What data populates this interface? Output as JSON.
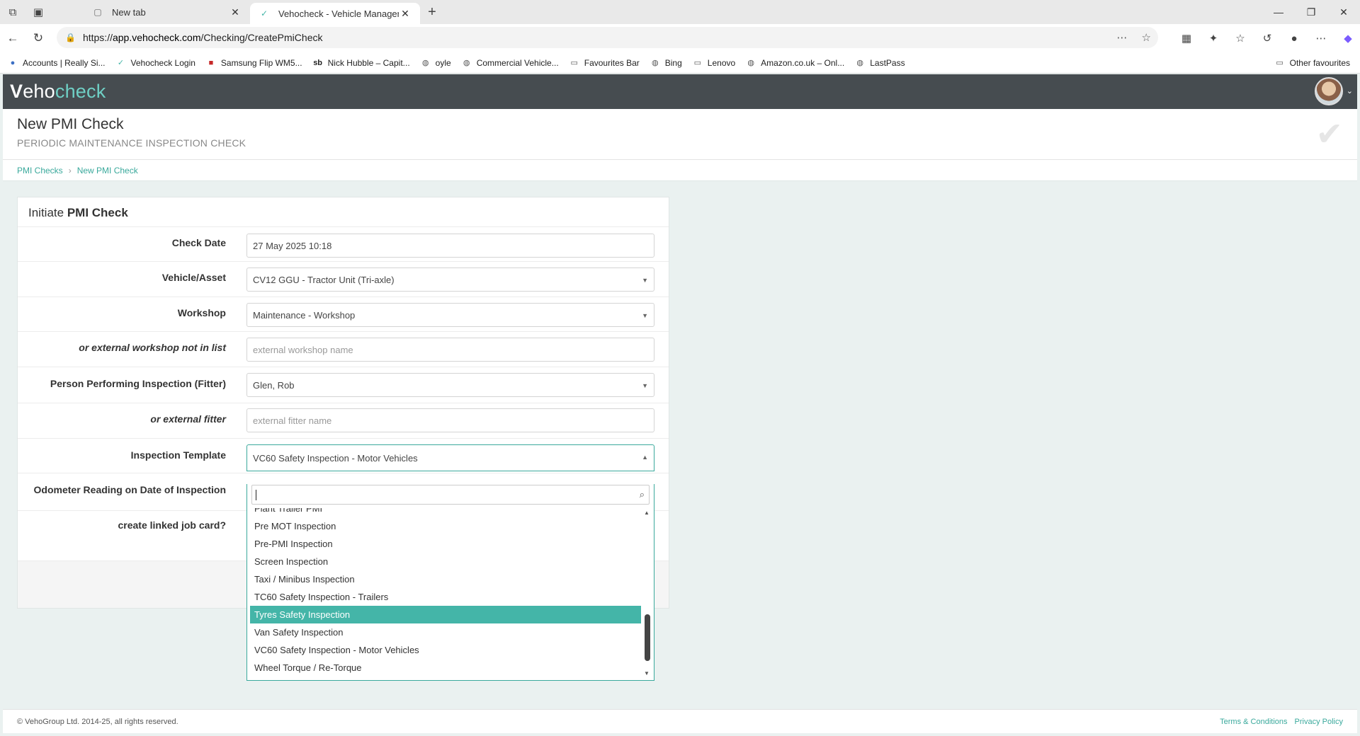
{
  "browser": {
    "tabs": [
      {
        "title": "New tab",
        "favicon": "page-icon"
      },
      {
        "title": "Vehocheck - Vehicle Management",
        "favicon": "vehocheck-icon"
      }
    ],
    "url_prefix": "https://",
    "url_host": "app.vehocheck.com",
    "url_path": "/Checking/CreatePmiCheck",
    "bookmarks": [
      "Accounts | Really Si...",
      "Vehocheck Login",
      "Samsung Flip WM5...",
      "Nick Hubble – Capit...",
      "oyle",
      "Commercial Vehicle...",
      "Favourites Bar",
      "Bing",
      "Lenovo",
      "Amazon.co.uk – Onl...",
      "LastPass"
    ],
    "other_favourites": "Other favourites"
  },
  "app": {
    "logo_v": "V",
    "logo_eho": "eho",
    "logo_check": "check",
    "brand_color": "#44b5a8",
    "header_color": "#464c50"
  },
  "page": {
    "title": "New PMI Check",
    "subtitle": "PERIODIC MAINTENANCE INSPECTION CHECK",
    "breadcrumb": [
      "PMI Checks",
      "New PMI Check"
    ]
  },
  "form": {
    "card_title_prefix": "Initiate ",
    "card_title_bold": "PMI Check",
    "check_date_label": "Check Date",
    "check_date_value": "27 May 2025 10:18",
    "vehicle_label": "Vehicle/Asset",
    "vehicle_value": "CV12 GGU - Tractor Unit (Tri-axle)",
    "workshop_label": "Workshop",
    "workshop_value": "Maintenance - Workshop",
    "ext_workshop_label": "or external workshop not in list",
    "ext_workshop_placeholder": "external workshop name",
    "fitter_label": "Person Performing Inspection (Fitter)",
    "fitter_value": "Glen, Rob",
    "ext_fitter_label": "or external fitter",
    "ext_fitter_placeholder": "external fitter name",
    "template_label": "Inspection Template",
    "template_value": "VC60 Safety Inspection - Motor Vehicles",
    "odometer_label": "Odometer Reading on Date of Inspection",
    "jobcard_label": "create linked job card?"
  },
  "dropdown": {
    "options": [
      "Plant Trailer PMI",
      "Pre MOT Inspection",
      "Pre-PMI Inspection",
      "Screen Inspection",
      "Taxi / Minibus Inspection",
      "TC60 Safety Inspection - Trailers",
      "Tyres Safety Inspection",
      "Van Safety Inspection",
      "VC60 Safety Inspection - Motor Vehicles",
      "Wheel Torque / Re-Torque"
    ],
    "highlighted": "Tyres Safety Inspection"
  },
  "footer": {
    "copyright": "© VehoGroup Ltd. 2014-25, all rights reserved.",
    "terms": "Terms & Conditions",
    "privacy": "Privacy Policy"
  }
}
